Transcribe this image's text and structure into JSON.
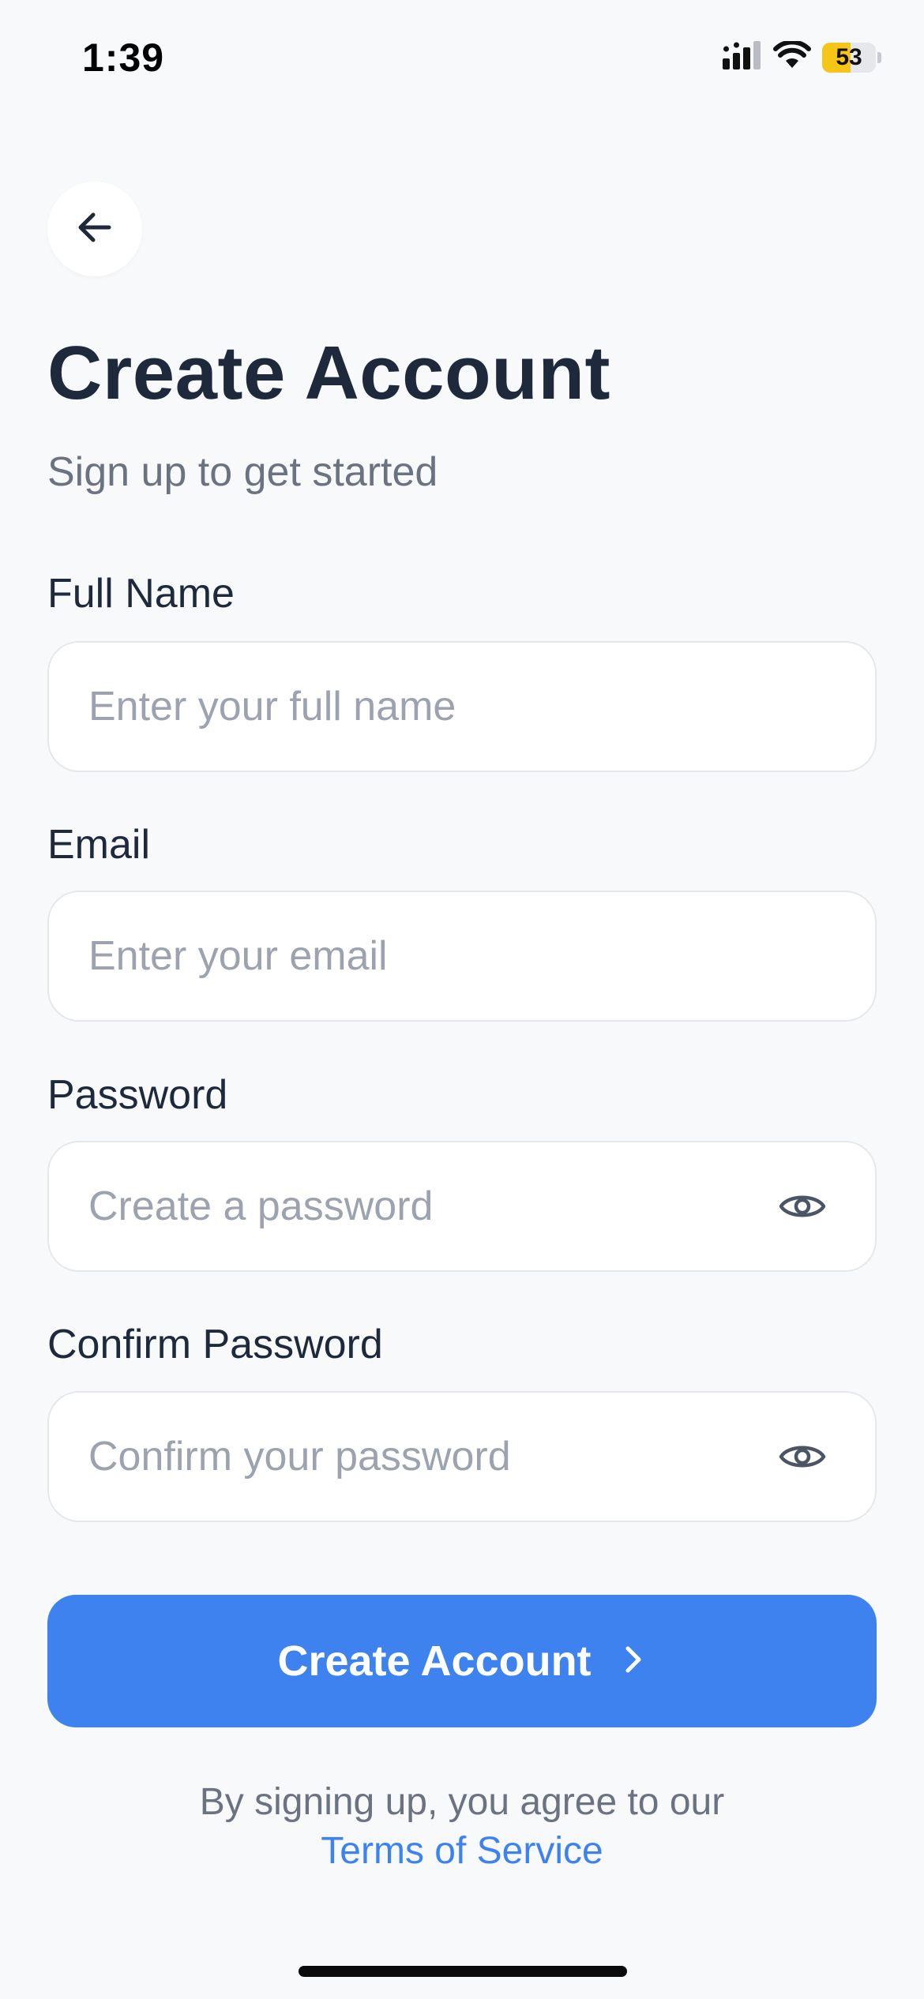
{
  "status_bar": {
    "time": "1:39",
    "battery_level": 53,
    "battery_label": "53",
    "icons": [
      "cellular-signal-icon",
      "wifi-icon",
      "battery-icon"
    ]
  },
  "header": {
    "back_icon": "arrow-left-icon",
    "title": "Create Account",
    "subtitle": "Sign up to get started"
  },
  "form": {
    "fields": [
      {
        "label": "Full Name",
        "placeholder": "Enter your full name",
        "value": "",
        "type": "text"
      },
      {
        "label": "Email",
        "placeholder": "Enter your email",
        "value": "",
        "type": "email"
      },
      {
        "label": "Password",
        "placeholder": "Create a password",
        "value": "",
        "type": "password",
        "toggle_icon": "eye-icon"
      },
      {
        "label": "Confirm Password",
        "placeholder": "Confirm your password",
        "value": "",
        "type": "password",
        "toggle_icon": "eye-icon"
      }
    ],
    "submit_label": "Create Account",
    "submit_icon": "chevron-right-icon"
  },
  "footer": {
    "agreement_text": "By signing up, you agree to our",
    "terms_link": "Terms of Service"
  },
  "colors": {
    "background": "#f8f9fb",
    "primary": "#3e82f0",
    "title": "#1e2a3b",
    "muted": "#6b7280",
    "placeholder": "#9ca3af",
    "border": "#e5e7eb",
    "battery": "#f5c518"
  }
}
